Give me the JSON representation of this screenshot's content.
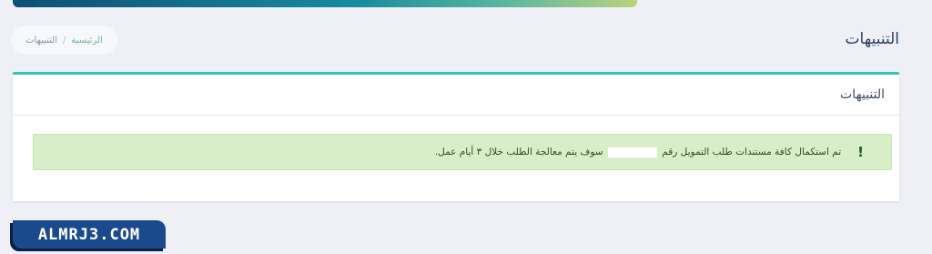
{
  "header": {
    "title": "التنبيهات"
  },
  "breadcrumb": {
    "home": "الرئيسية",
    "separator": "/",
    "current": "التنبيهات"
  },
  "card": {
    "title": "التنبيهات"
  },
  "alert": {
    "icon": "!",
    "text_before": "تم استكمال كافة مستندات طلب التمويل رقم",
    "text_after": "سوف يتم معالجة الطلب خلال ٣ أيام عمل."
  },
  "watermark": {
    "text": "ALMRJ3.COM"
  },
  "colors": {
    "accent": "#35c3b5",
    "alert_bg": "#d7eec9",
    "brand": "#1b4a8c"
  }
}
